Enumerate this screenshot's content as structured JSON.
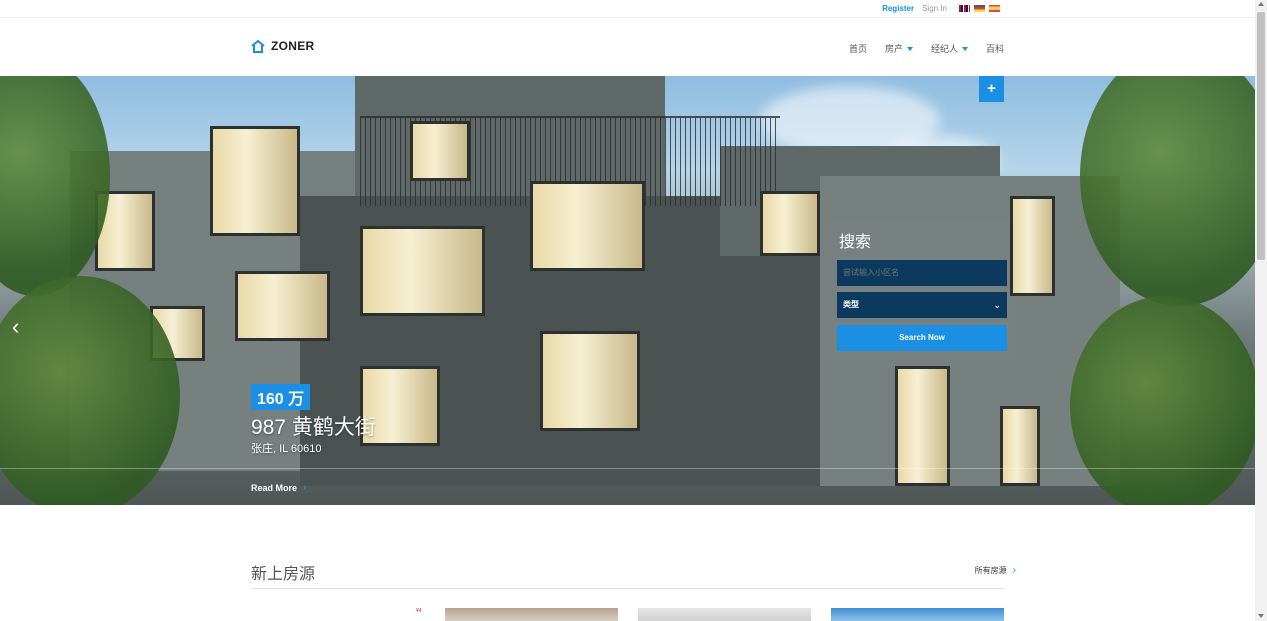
{
  "topbar": {
    "register_label": "Register",
    "signin_label": "Sign In",
    "languages": [
      "english-flag",
      "german-flag",
      "spanish-flag"
    ]
  },
  "header": {
    "logo_text": "ZONER",
    "nav": [
      {
        "label": "首页",
        "has_dropdown": false
      },
      {
        "label": "房产",
        "has_dropdown": true
      },
      {
        "label": "经纪人",
        "has_dropdown": true
      },
      {
        "label": "百科",
        "has_dropdown": false
      }
    ]
  },
  "hero": {
    "price": "160 万",
    "title": "987 黄鹤大街",
    "subtitle": "张庄, IL 60610",
    "read_more": "Read More",
    "plus_icon": "+",
    "prev_icon": "‹"
  },
  "search": {
    "title": "搜索",
    "input_placeholder": "尝试输入小区名",
    "type_label": "类型",
    "button_label": "Search Now"
  },
  "listings": {
    "title": "新上房源",
    "all_link": "所有房源",
    "thumb_tag": "¥4"
  },
  "colors": {
    "accent": "#1a8fe3",
    "input_bg": "#0b3a5e"
  }
}
